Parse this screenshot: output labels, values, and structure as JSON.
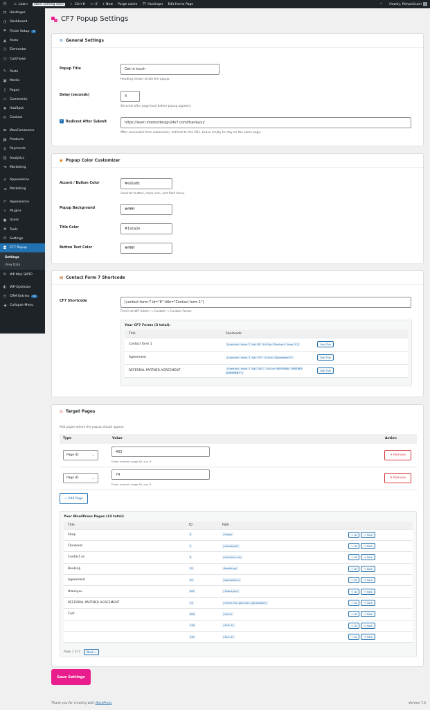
{
  "adminbar": {
    "site": "Learn",
    "store_badge": "Store coming soon",
    "shortcut": "Ctrl+K",
    "comments": "0",
    "new": "+ New",
    "purge": "Purge cache",
    "hostinger": "Hostinger",
    "edit": "Edit Home Page",
    "howdy": "Howdy, Relyon1sam"
  },
  "sidebar": {
    "items": [
      {
        "icon": "hostinger-icon",
        "label": "Hostinger"
      },
      {
        "icon": "dashboard-icon",
        "label": "Dashboard"
      },
      {
        "icon": "finish-setup-icon",
        "label": "Finish Setup",
        "badge": "3"
      },
      {
        "icon": "astra-icon",
        "label": "Astra"
      },
      {
        "icon": "elementor-icon",
        "label": "Elementor"
      },
      {
        "icon": "cartflows-icon",
        "label": "CartFlows"
      },
      {
        "icon": "posts-icon",
        "label": "Posts"
      },
      {
        "icon": "media-icon",
        "label": "Media"
      },
      {
        "icon": "pages-icon",
        "label": "Pages"
      },
      {
        "icon": "comments-icon",
        "label": "Comments"
      },
      {
        "icon": "hubspot-icon",
        "label": "HubSpot"
      },
      {
        "icon": "contact-icon",
        "label": "Contact"
      },
      {
        "icon": "woocommerce-icon",
        "label": "WooCommerce"
      },
      {
        "icon": "products-icon",
        "label": "Products"
      },
      {
        "icon": "payments-icon",
        "label": "Payments"
      },
      {
        "icon": "analytics-icon",
        "label": "Analytics"
      },
      {
        "icon": "marketing-icon",
        "label": "Marketing"
      },
      {
        "icon": "appearance-icon",
        "label": "Appearance"
      },
      {
        "icon": "marketing-icon",
        "label": "Marketing"
      },
      {
        "icon": "appearance-icon",
        "label": "Appearance"
      },
      {
        "icon": "plugins-icon",
        "label": "Plugins"
      },
      {
        "icon": "users-icon",
        "label": "Users"
      },
      {
        "icon": "tools-icon",
        "label": "Tools"
      },
      {
        "icon": "settings-icon",
        "label": "Settings"
      }
    ],
    "active": {
      "icon": "popup-icon",
      "label": "CF7 Popup"
    },
    "sub": [
      "Settings",
      "View Data"
    ],
    "bottom": [
      {
        "icon": "mail-icon",
        "label": "WP Mail SMTP"
      },
      {
        "icon": "optimize-icon",
        "label": "WP-Optimize"
      },
      {
        "icon": "crm-icon",
        "label": "CRM Entries",
        "badge": "32"
      },
      {
        "icon": "collapse-icon",
        "label": "Collapse Menu"
      }
    ]
  },
  "page": {
    "title": "CF7 Popup Settings"
  },
  "general": {
    "heading": "General Settings",
    "popup_title_label": "Popup Title",
    "popup_title_value": "Get in touch",
    "popup_title_desc": "Heading shown inside the popup.",
    "delay_label": "Delay (seconds)",
    "delay_value": "4",
    "delay_desc": "Seconds after page load before popup appears.",
    "redirect_label": "Redirect After Submit",
    "redirect_value": "https://learn.interiordesign24x7.com/thankyou/",
    "redirect_desc": "After successful form submission, redirect to this URL. Leave empty to stay on the same page."
  },
  "colors": {
    "heading": "Popup Color Customizer",
    "accent_label": "Accent / Button Color",
    "accent_value": "#e91e8c",
    "accent_desc": "Used for button, close icon, and field focus.",
    "bg_label": "Popup Background",
    "bg_value": "#ffffff",
    "title_label": "Title Color",
    "title_value": "#1a1a2e",
    "btn_text_label": "Button Text Color",
    "btn_text_value": "#ffffff"
  },
  "cf7": {
    "heading": "Contact Form 7 Shortcode",
    "shortcode_label": "CF7 Shortcode",
    "shortcode_value": "[contact-form-7 id=\"6\" title=\"Contact form 1\"]",
    "shortcode_desc": "Find it at WP Admin → Contact → Contact Forms.",
    "forms_heading": "Your CF7 Forms (3 total):",
    "col_title": "Title",
    "col_shortcode": "Shortcode",
    "use_label": "Use This",
    "forms": [
      {
        "title": "Contact form 1",
        "code": "[contact-form-7 id=\"6\" title=\"Contact form 1\"]"
      },
      {
        "title": "Agreement",
        "code": "[contact-form-7 id=\"27\" title=\"Agreement\"]"
      },
      {
        "title": "REFERRAL PARTNER AGREEMENT",
        "code": "[contact-form-7 id=\"101\" title=\"REFERRAL PARTNER AGREEMENT\"]"
      }
    ]
  },
  "targets": {
    "heading": "Target Pages",
    "desc": "Add pages where the popup should appear.",
    "col_type": "Type",
    "col_value": "Value",
    "col_action": "Action",
    "rows": [
      {
        "type": "Page ID",
        "value": "483",
        "hint": "Enter numeric page ID, e.g. 9"
      },
      {
        "type": "Page ID",
        "value": "74",
        "hint": "Enter numeric page ID, e.g. 9"
      }
    ],
    "remove_label": "✕ Remove",
    "add_label": "+ Add Page",
    "pages_heading": "Your WordPress Pages (14 total):",
    "pcol_title": "Title",
    "pcol_id": "ID",
    "pcol_path": "Path",
    "btn_id": "+ ID",
    "btn_path": "+ Path",
    "pages": [
      {
        "title": "Shop",
        "id": "5",
        "path": "/shop/"
      },
      {
        "title": "Checkout",
        "id": "7",
        "path": "/checkout/"
      },
      {
        "title": "Contact us",
        "id": "9",
        "path": "/contact-us/"
      },
      {
        "title": "Booking",
        "id": "15",
        "path": "/booking/"
      },
      {
        "title": "Agreement",
        "id": "22",
        "path": "/agreement/"
      },
      {
        "title": "thankyou",
        "id": "561",
        "path": "/thankyou/"
      },
      {
        "title": "REFERRAL PARTNER AGREEMENT",
        "id": "74",
        "path": "/referral-partner-agreement/"
      },
      {
        "title": "Cart",
        "id": "369",
        "path": "/cart/"
      },
      {
        "title": "",
        "id": "110",
        "path": "/110-2/"
      },
      {
        "title": "",
        "id": "111",
        "path": "/111-2/"
      }
    ],
    "pager": "Page 1 of 2",
    "next": "Next →"
  },
  "save_label": "Save Settings",
  "footer": {
    "thanks": "Thank you for creating with",
    "wp": "WordPress",
    "version": "Version 7.0"
  }
}
